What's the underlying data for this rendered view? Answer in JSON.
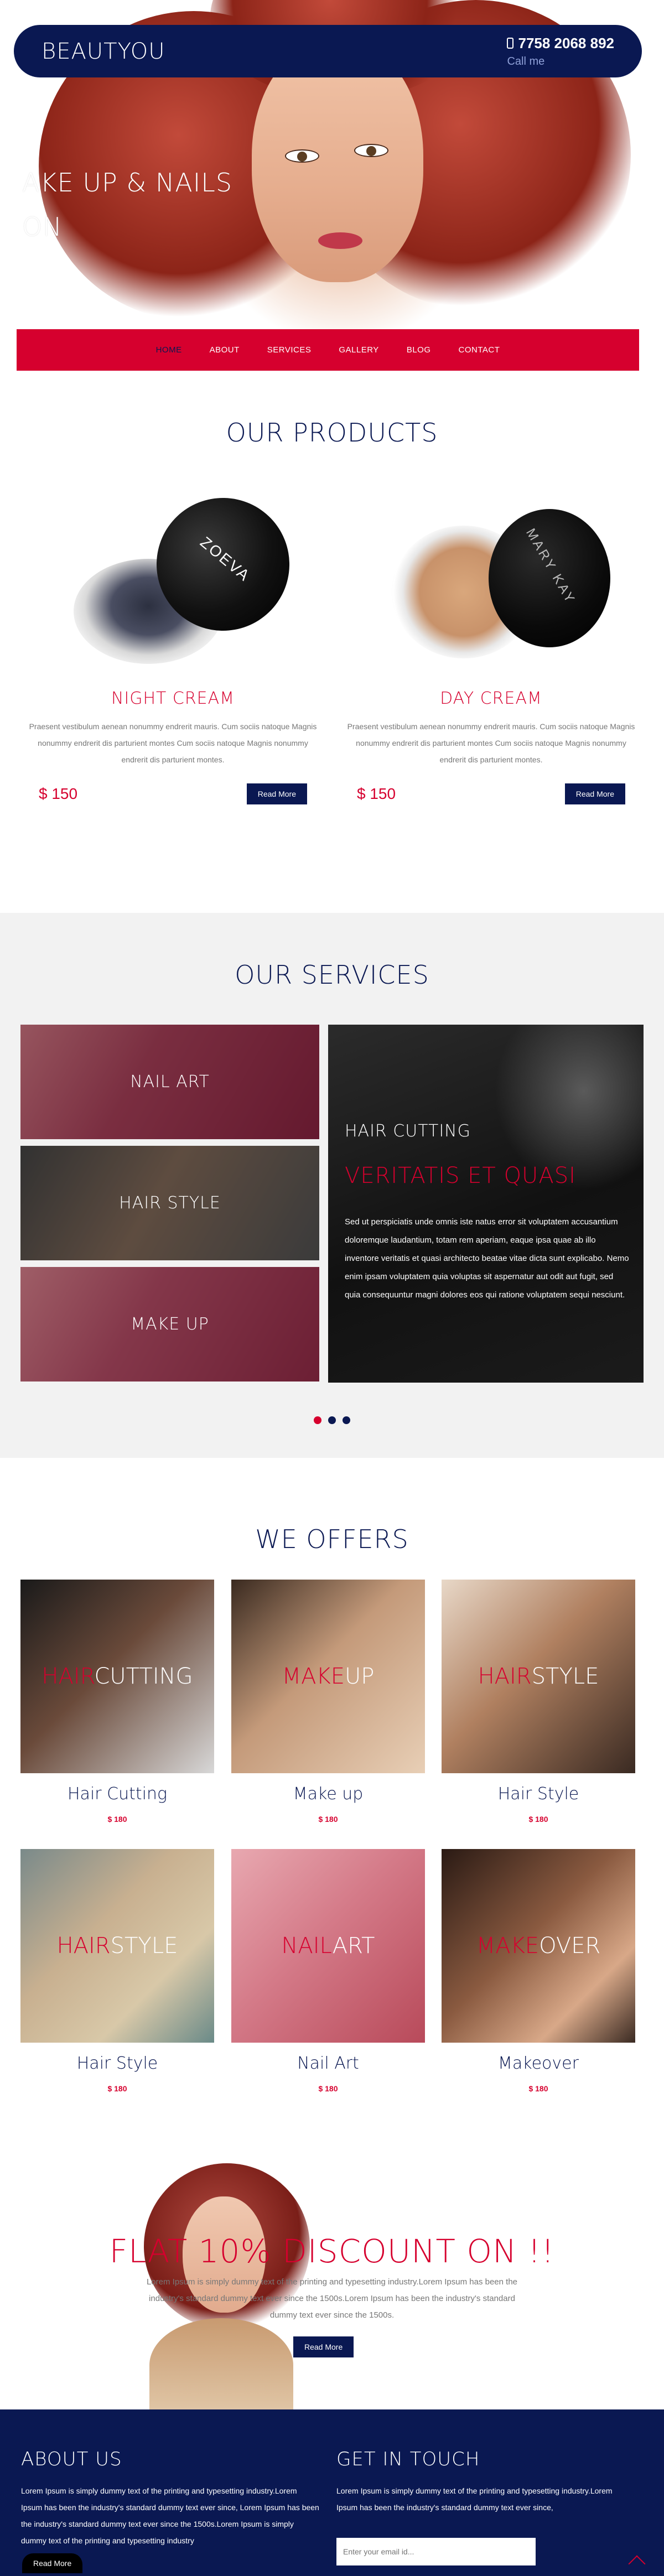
{
  "brand": "BEAUTYOU",
  "header": {
    "phone": "7758 2068 892",
    "call_label": "Call me"
  },
  "hero": {
    "line1": "AKE UP & NAILS",
    "line2": "ON"
  },
  "nav": [
    {
      "label": "HOME",
      "active": true
    },
    {
      "label": "ABOUT"
    },
    {
      "label": "SERVICES"
    },
    {
      "label": "GALLERY"
    },
    {
      "label": "BLOG"
    },
    {
      "label": "CONTACT"
    }
  ],
  "products": {
    "title": "OUR PRODUCTS",
    "items": [
      {
        "brand_mark": "ZOEVA",
        "name": "NIGHT CREAM",
        "desc": "Praesent vestibulum aenean nonummy endrerit mauris. Cum sociis natoque Magnis nonummy endrerit dis parturient montes Cum sociis natoque Magnis nonummy endrerit dis parturient montes.",
        "price": "$ 150",
        "button": "Read More"
      },
      {
        "brand_mark": "MARY KAY",
        "name": "DAY CREAM",
        "desc": "Praesent vestibulum aenean nonummy endrerit mauris. Cum sociis natoque Magnis nonummy endrerit dis parturient montes Cum sociis natoque Magnis nonummy endrerit dis parturient montes.",
        "price": "$ 150",
        "button": "Read More"
      }
    ]
  },
  "services": {
    "title": "OUR SERVICES",
    "tiles": [
      "NAIL ART",
      "HAIR STYLE",
      "MAKE UP"
    ],
    "featured": {
      "title": "HAIR CUTTING",
      "subtitle": "VERITATIS ET QUASI",
      "text": "Sed ut perspiciatis unde omnis iste natus error sit voluptatem accusantium doloremque laudantium, totam rem aperiam, eaque ipsa quae ab illo inventore veritatis et quasi architecto beatae vitae dicta sunt explicabo. Nemo enim ipsam voluptatem quia voluptas sit aspernatur aut odit aut fugit, sed quia consequuntur magni dolores eos qui ratione voluptatem sequi nesciunt."
    },
    "slider_dots": 3,
    "active_dot": 0
  },
  "offers": {
    "title": "WE OFFERS",
    "items": [
      {
        "overlay_red": "HAIR",
        "overlay_white": "CUTTING",
        "name": "Hair Cutting",
        "price": "$ 180"
      },
      {
        "overlay_red": "MAKE",
        "overlay_white": "UP",
        "name": "Make up",
        "price": "$ 180"
      },
      {
        "overlay_red": "HAIR",
        "overlay_white": "STYLE",
        "name": "Hair Style",
        "price": "$ 180"
      },
      {
        "overlay_red": "HAIR",
        "overlay_white": "STYLE",
        "name": "Hair Style",
        "price": "$ 180"
      },
      {
        "overlay_red": "NAIL",
        "overlay_white": "ART",
        "name": "Nail Art",
        "price": "$ 180"
      },
      {
        "overlay_red": "MAKE",
        "overlay_white": "OVER",
        "name": "Makeover",
        "price": "$ 180"
      }
    ]
  },
  "discount": {
    "title": "FLAT 10% DISCOUNT ON !!",
    "text": "Lorem Ipsum is simply dummy text of the printing and typesetting industry.Lorem Ipsum has been the industry's standard dummy text ever since the 1500s.Lorem Ipsum has been the industry's standard dummy text ever since the 1500s.",
    "button": "Read More"
  },
  "footer": {
    "about_title": "ABOUT US",
    "about_text": "Lorem Ipsum is simply dummy text of the printing and typesetting industry.Lorem Ipsum has been the industry's standard dummy text ever since, Lorem Ipsum has been the industry's standard dummy text ever since the 1500s.Lorem Ipsum is simply dummy text of the printing and typesetting industry",
    "contact_title": "GET IN TOUCH",
    "contact_text": "Lorem Ipsum is simply dummy text of the printing and typesetting industry.Lorem Ipsum has been the industry's standard dummy text ever since,",
    "email_placeholder": "Enter your email id...",
    "read_more": "Read More"
  },
  "colors": {
    "navy": "#0a1852",
    "red": "#d6002e",
    "light_bg": "#f2f2f2"
  }
}
